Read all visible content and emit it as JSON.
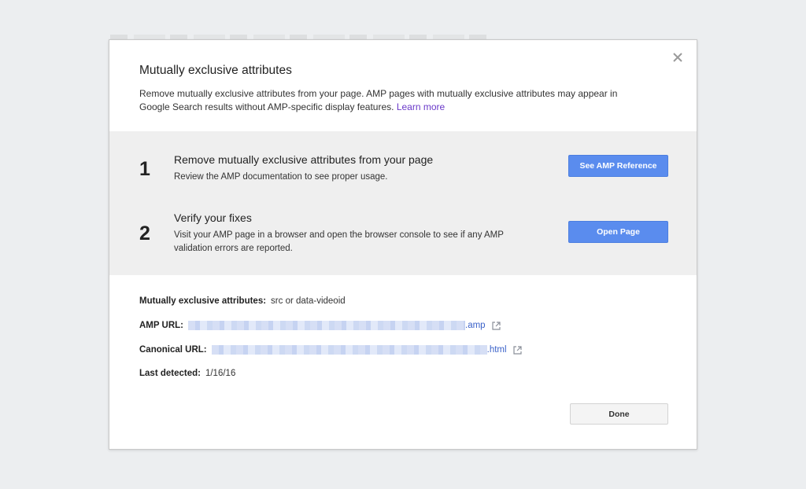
{
  "dialog": {
    "title": "Mutually exclusive attributes",
    "description": "Remove mutually exclusive attributes from your page. AMP pages with mutually exclusive attributes may appear in Google Search results without AMP-specific display features.",
    "learn_more": "Learn more",
    "close_icon": "close-icon"
  },
  "steps": [
    {
      "number": "1",
      "title": "Remove mutually exclusive attributes from your page",
      "body": "Review the AMP documentation to see proper usage.",
      "button": "See AMP Reference"
    },
    {
      "number": "2",
      "title": "Verify your fixes",
      "body": "Visit your AMP page in a browser and open the browser console to see if any AMP validation errors are reported.",
      "button": "Open Page"
    }
  ],
  "details": {
    "attributes_label": "Mutually exclusive attributes:",
    "attributes_value": "src or data-videoid",
    "amp_url_label": "AMP URL:",
    "amp_url_suffix": ".amp",
    "canonical_url_label": "Canonical URL:",
    "canonical_url_suffix": ".html",
    "last_detected_label": "Last detected:",
    "last_detected_value": "1/16/16",
    "external_link_icon": "external-link-icon"
  },
  "footer": {
    "done_label": "Done"
  },
  "colors": {
    "primary_button": "#5a8cee",
    "link": "#3b62c9",
    "learn_more_link": "#6a39c9",
    "steps_background": "#efefef",
    "page_background": "#eceef0"
  }
}
